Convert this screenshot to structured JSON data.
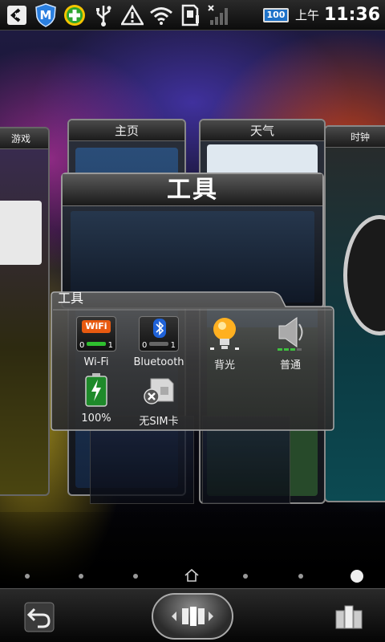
{
  "status_bar": {
    "battery_level": "100",
    "ampm": "上午",
    "time": "11:36",
    "icons": [
      "usb-debug-icon",
      "shield-m-icon",
      "app-store-plus-icon",
      "usb-icon",
      "warning-icon",
      "wifi-icon",
      "sd-card-icon",
      "no-signal-icon"
    ]
  },
  "screens": {
    "left_far": "游戏",
    "left": "主页",
    "right": "天气",
    "right_far": "时钟"
  },
  "title_card": {
    "title": "工具"
  },
  "folder": {
    "title": "工具",
    "items": [
      {
        "label": "Wi-Fi",
        "icon": "wifi-toggle-icon",
        "badge": "WiFi",
        "left_num": "0",
        "right_num": "1",
        "state": "on"
      },
      {
        "label": "Bluetooth",
        "icon": "bluetooth-toggle-icon",
        "left_num": "0",
        "right_num": "1",
        "state": "off"
      },
      {
        "label": "背光",
        "icon": "backlight-bulb-icon"
      },
      {
        "label": "普通",
        "icon": "speaker-icon"
      },
      {
        "label": "100%",
        "icon": "battery-icon"
      },
      {
        "label": "无SIM卡",
        "icon": "no-sim-icon"
      }
    ]
  },
  "page_indicator": {
    "pages": 7,
    "home_index": 3,
    "active_index": 6
  },
  "dock": {
    "left": "back-arrow-icon",
    "center": "app-drawer-icon",
    "right": "screens-preview-icon"
  }
}
